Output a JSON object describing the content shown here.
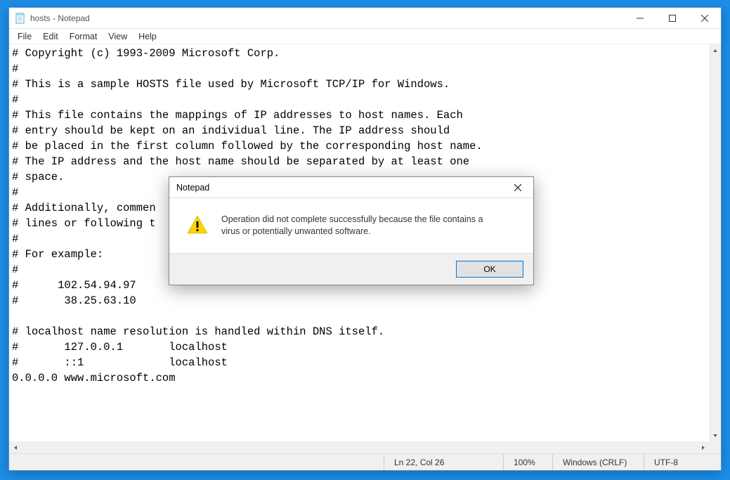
{
  "window": {
    "title": "hosts - Notepad"
  },
  "menubar": {
    "file": "File",
    "edit": "Edit",
    "format": "Format",
    "view": "View",
    "help": "Help"
  },
  "editor": {
    "content": "# Copyright (c) 1993-2009 Microsoft Corp.\n#\n# This is a sample HOSTS file used by Microsoft TCP/IP for Windows.\n#\n# This file contains the mappings of IP addresses to host names. Each\n# entry should be kept on an individual line. The IP address should\n# be placed in the first column followed by the corresponding host name.\n# The IP address and the host name should be separated by at least one\n# space.\n#\n# Additionally, commen\n# lines or following t\n#\n# For example:\n#\n#      102.54.94.97\n#       38.25.63.10\n\n# localhost name resolution is handled within DNS itself.\n#       127.0.0.1       localhost\n#       ::1             localhost\n0.0.0.0 www.microsoft.com"
  },
  "statusbar": {
    "position": "Ln 22, Col 26",
    "zoom": "100%",
    "line_ending": "Windows (CRLF)",
    "encoding": "UTF-8"
  },
  "dialog": {
    "title": "Notepad",
    "message": "Operation did not complete successfully because the file contains a virus or potentially unwanted software.",
    "ok_label": "OK"
  }
}
